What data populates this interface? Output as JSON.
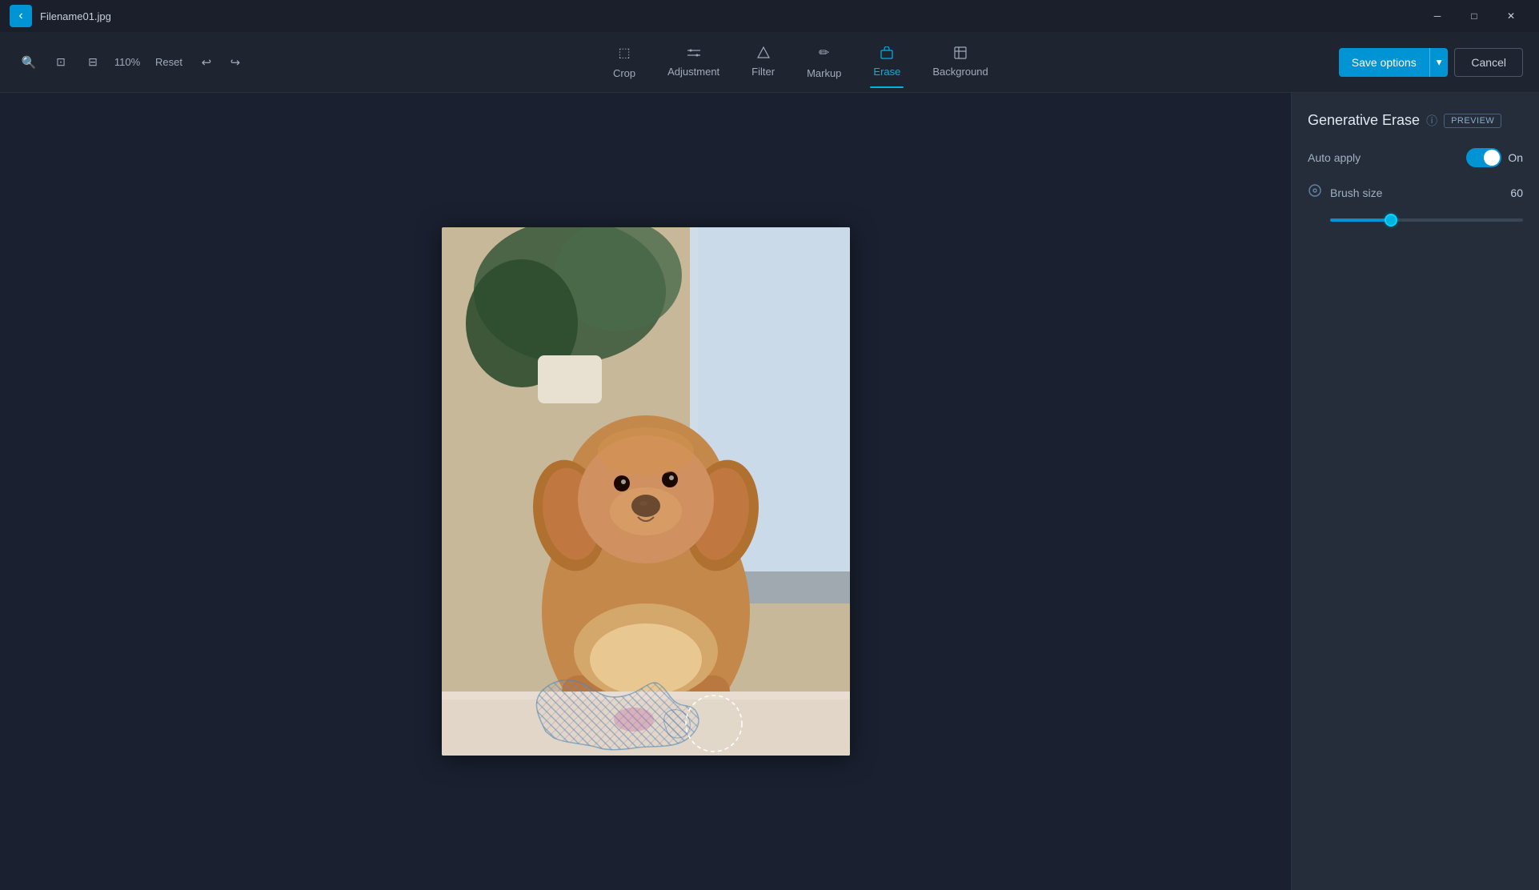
{
  "titlebar": {
    "filename": "Filename01.jpg",
    "min_label": "─",
    "max_label": "□",
    "close_label": "✕"
  },
  "toolbar": {
    "zoom_level": "110%",
    "reset_label": "Reset",
    "undo_label": "↩",
    "redo_label": "↪",
    "tabs": [
      {
        "id": "crop",
        "label": "Crop",
        "icon": "⬚",
        "active": false
      },
      {
        "id": "adjustment",
        "label": "Adjustment",
        "icon": "✦",
        "active": false
      },
      {
        "id": "filter",
        "label": "Filter",
        "icon": "⬡",
        "active": false
      },
      {
        "id": "markup",
        "label": "Markup",
        "icon": "✏",
        "active": false
      },
      {
        "id": "erase",
        "label": "Erase",
        "icon": "◈",
        "active": true
      },
      {
        "id": "background",
        "label": "Background",
        "icon": "⊞",
        "active": false
      }
    ],
    "save_options_label": "Save options",
    "cancel_label": "Cancel"
  },
  "right_panel": {
    "title": "Generative Erase",
    "preview_label": "PREVIEW",
    "auto_apply_label": "Auto apply",
    "auto_apply_on": "On",
    "toggle_on": true,
    "brush_size_label": "Brush size",
    "brush_size_value": "60",
    "brush_slider_percent": 30
  },
  "icons": {
    "back": "‹",
    "zoom_out": "🔍",
    "zoom_fit": "⊡",
    "zoom_square": "⊟",
    "info": "ⓘ",
    "chevron_down": "▾",
    "brush": "⊙"
  }
}
